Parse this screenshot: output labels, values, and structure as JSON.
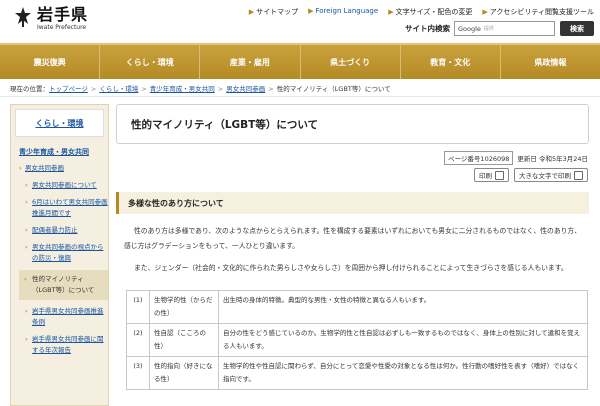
{
  "header": {
    "logo_name": "岩手県",
    "logo_en": "Iwate Prefecture",
    "util_links": [
      {
        "label": "サイトマップ",
        "mark": "▶"
      },
      {
        "label": "Foreign Language",
        "mark": "▶"
      },
      {
        "label": "文字サイズ・配色の変更",
        "mark": "▶"
      },
      {
        "label": "アクセシビリティ閲覧支援ツール",
        "mark": "▶"
      }
    ],
    "search_label": "サイト内検索",
    "search_brand": "Google",
    "search_hint": "提供",
    "search_button": "検索"
  },
  "nav": [
    "震災復興",
    "くらし・環境",
    "産業・雇用",
    "県土づくり",
    "教育・文化",
    "県政情報"
  ],
  "breadcrumb": {
    "prefix": "現在の位置：",
    "items": [
      "トップページ",
      "くらし・環境",
      "青少年育成・男女共同",
      "男女共同参画"
    ],
    "current": "性的マイノリティ（LGBT等）について",
    "separator": ">"
  },
  "sidebar": {
    "head": "くらし・環境",
    "sub": "青少年育成・男女共同",
    "items": [
      {
        "label": "男女共同参画",
        "level": "top"
      },
      {
        "label": "男女共同参画について",
        "level": "sub"
      },
      {
        "label": "6月はいわて男女共同参画推進月間です",
        "level": "sub"
      },
      {
        "label": "配偶者暴力防止",
        "level": "sub"
      },
      {
        "label": "男女共同参画の視点からの防災・復興",
        "level": "sub"
      },
      {
        "label": "性的マイノリティ（LGBT等）について",
        "level": "current"
      },
      {
        "label": "岩手県男女共同参画推進条例",
        "level": "sub"
      },
      {
        "label": "岩手県男女共同参画に関する年次報告",
        "level": "sub"
      }
    ]
  },
  "main": {
    "title": "性的マイノリティ（LGBT等）について",
    "page_id": "ページ番号1026098",
    "updated": "更新日 令和5年3月24日",
    "print_label": "印刷",
    "big_print_label": "大きな文字で印刷",
    "section_title": "多様な性のあり方について",
    "para1": "性のあり方は多様であり、次のような点からとらえられます。性を構成する要素はいずれにおいても男女に二分されるものではなく、性のあり方、感じ方はグラデーションをもって、一人ひとり違います。",
    "para2": "また、ジェンダー（社会的・文化的に作られた男らしさや女らしさ）を周囲から押し付けられることによって生きづらさを感じる人もいます。",
    "table": [
      {
        "num": "(1)",
        "term": "生物学的性（からだの性）",
        "desc": "出生時の身体的特徴。典型的な男性・女性の特徴と異なる人もいます。"
      },
      {
        "num": "(2)",
        "term": "性自認（こころの性）",
        "desc": "自分の性をどう感じているのか。生物学的性と性自認は必ずしも一致するものではなく、身体上の性別に対して違和を覚える人もいます。"
      },
      {
        "num": "(3)",
        "term": "性的指向（好きになる性）",
        "desc": "生物学的性や性自認に関わらず、自分にとって恋愛や性愛の対象となる性は何か。性行動の嗜好性を表す（嗜好）ではなく指向です。"
      }
    ]
  }
}
